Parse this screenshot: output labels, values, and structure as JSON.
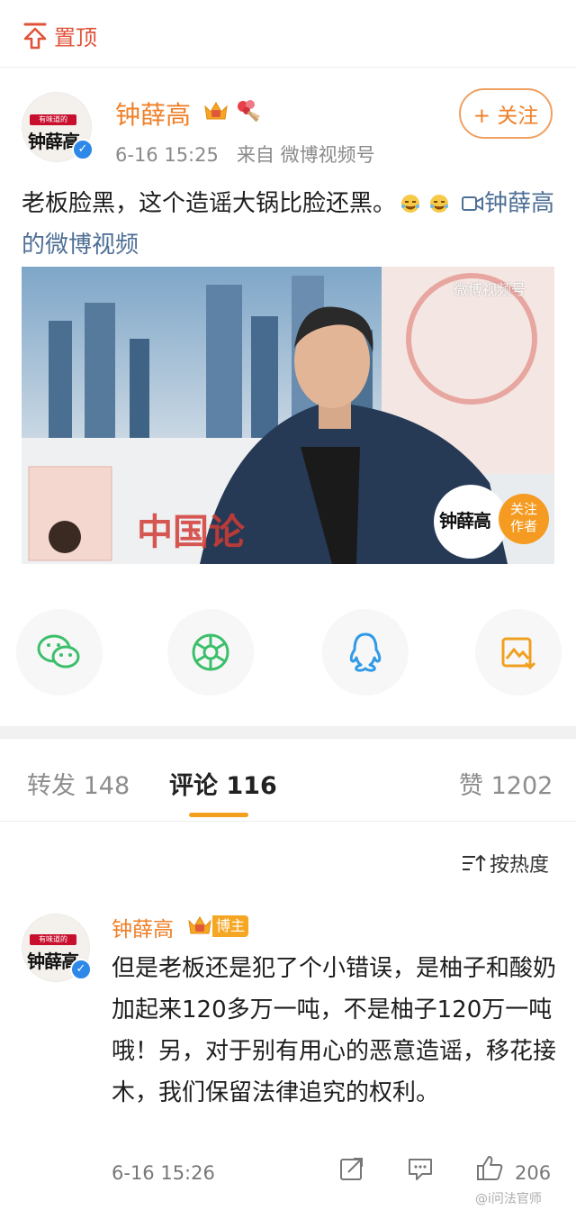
{
  "topbar": {
    "pin_label": "置顶"
  },
  "post": {
    "author": "钟薛高",
    "time": "6-16 15:25",
    "source_prefix": "来自",
    "source": "微博视频号",
    "follow_label": "+ 关注",
    "text": "老板脸黑，这个造谣大锅比脸还黑。",
    "link_icon": "video-camera-icon",
    "link_text": "钟薛高的微博视频",
    "avatar_brand_top": "有味道的",
    "avatar_brand_name": "钟薛高"
  },
  "video": {
    "watermark": "微博视频号",
    "overlay_brand": "钟薛高",
    "follow_author_label_1": "关注",
    "follow_author_label_2": "作者",
    "backdrop_text": "中国论"
  },
  "share": {
    "items": [
      {
        "icon": "wechat-icon",
        "color": "#3cbf6a"
      },
      {
        "icon": "moments-icon",
        "color": "#3cbf6a"
      },
      {
        "icon": "qq-icon",
        "color": "#2f9ae8"
      },
      {
        "icon": "save-image-icon",
        "color": "#f0a020"
      }
    ]
  },
  "tabs": {
    "repost": "转发 148",
    "comments": "评论 116",
    "likes": "赞 1202"
  },
  "sort": {
    "label": "按热度"
  },
  "comment": {
    "author": "钟薛高",
    "badge": "博主",
    "text": "但是老板还是犯了个小错误，是柚子和酸奶加起来120多万一吨，不是柚子120万一吨哦！另，对于别有用心的恶意造谣，移花接木，我们保留法律追究的权利。",
    "time": "6-16 15:26",
    "likes": "206"
  },
  "watermark": "@i问法官师",
  "colors": {
    "accent": "#ef7f27",
    "link": "#4e6f96",
    "verified": "#2d88e8",
    "tab_underline": "#f3a01f"
  }
}
